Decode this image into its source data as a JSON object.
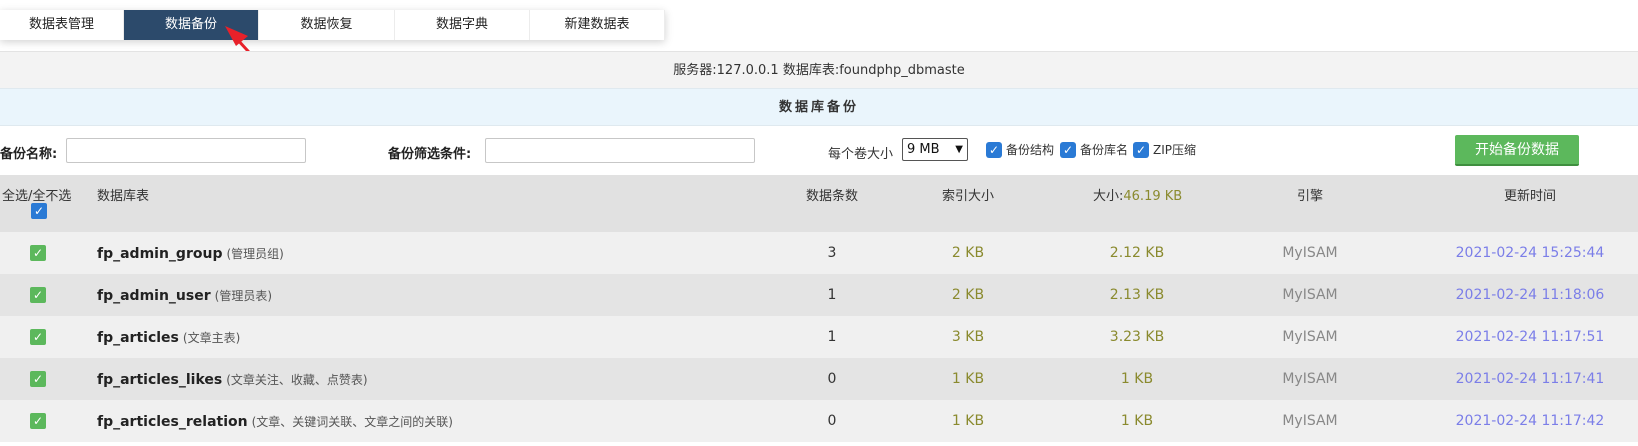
{
  "tabs": [
    {
      "label": "数据表管理",
      "active": false
    },
    {
      "label": "数据备份",
      "active": true
    },
    {
      "label": "数据恢复",
      "active": false
    },
    {
      "label": "数据字典",
      "active": false
    },
    {
      "label": "新建数据表",
      "active": false
    }
  ],
  "server_info": "服务器:127.0.0.1 数据库表:foundphp_dbmaste",
  "section_title": "数据库备份",
  "controls": {
    "backup_name_label": "备份名称:",
    "backup_name_value": "",
    "filter_label": "备份筛选条件:",
    "filter_value": "",
    "volume_label": "每个卷大小",
    "volume_value": "9 MB",
    "backup_structure_label": "备份结构",
    "backup_structure_checked": true,
    "backup_dbname_label": "备份库名",
    "backup_dbname_checked": true,
    "zip_label": "ZIP压缩",
    "zip_checked": true,
    "start_button": "开始备份数据"
  },
  "table": {
    "headers": {
      "select_all": "全选/全不选",
      "table_name": "数据库表",
      "rows": "数据条数",
      "index_size": "索引大小",
      "size_prefix": "大小:",
      "size_total": "46.19 KB",
      "engine": "引擎",
      "updated": "更新时间"
    },
    "rows": [
      {
        "name": "fp_admin_group",
        "desc": "(管理员组)",
        "rows": "3",
        "index": "2 KB",
        "size": "2.12 KB",
        "engine": "MyISAM",
        "updated": "2021-02-24 15:25:44",
        "checked": true
      },
      {
        "name": "fp_admin_user",
        "desc": "(管理员表)",
        "rows": "1",
        "index": "2 KB",
        "size": "2.13 KB",
        "engine": "MyISAM",
        "updated": "2021-02-24 11:18:06",
        "checked": true
      },
      {
        "name": "fp_articles",
        "desc": "(文章主表)",
        "rows": "1",
        "index": "3 KB",
        "size": "3.23 KB",
        "engine": "MyISAM",
        "updated": "2021-02-24 11:17:51",
        "checked": true
      },
      {
        "name": "fp_articles_likes",
        "desc": "(文章关注、收藏、点赞表)",
        "rows": "0",
        "index": "1 KB",
        "size": "1 KB",
        "engine": "MyISAM",
        "updated": "2021-02-24 11:17:41",
        "checked": true
      },
      {
        "name": "fp_articles_relation",
        "desc": "(文章、关键词关联、文章之间的关联)",
        "rows": "0",
        "index": "1 KB",
        "size": "1 KB",
        "engine": "MyISAM",
        "updated": "2021-02-24 11:17:42",
        "checked": true
      }
    ]
  },
  "colors": {
    "active_tab": "#2c4a6b",
    "start_button": "#5cb85c",
    "annotation_arrow": "#e8212a",
    "time_text": "#7b7ee8",
    "size_text": "#8a8a2e"
  },
  "icons": {
    "checkbox_checked": "check-icon",
    "select_chevron": "chevron-down-icon",
    "annotation": "arrow-annotation-icon"
  }
}
